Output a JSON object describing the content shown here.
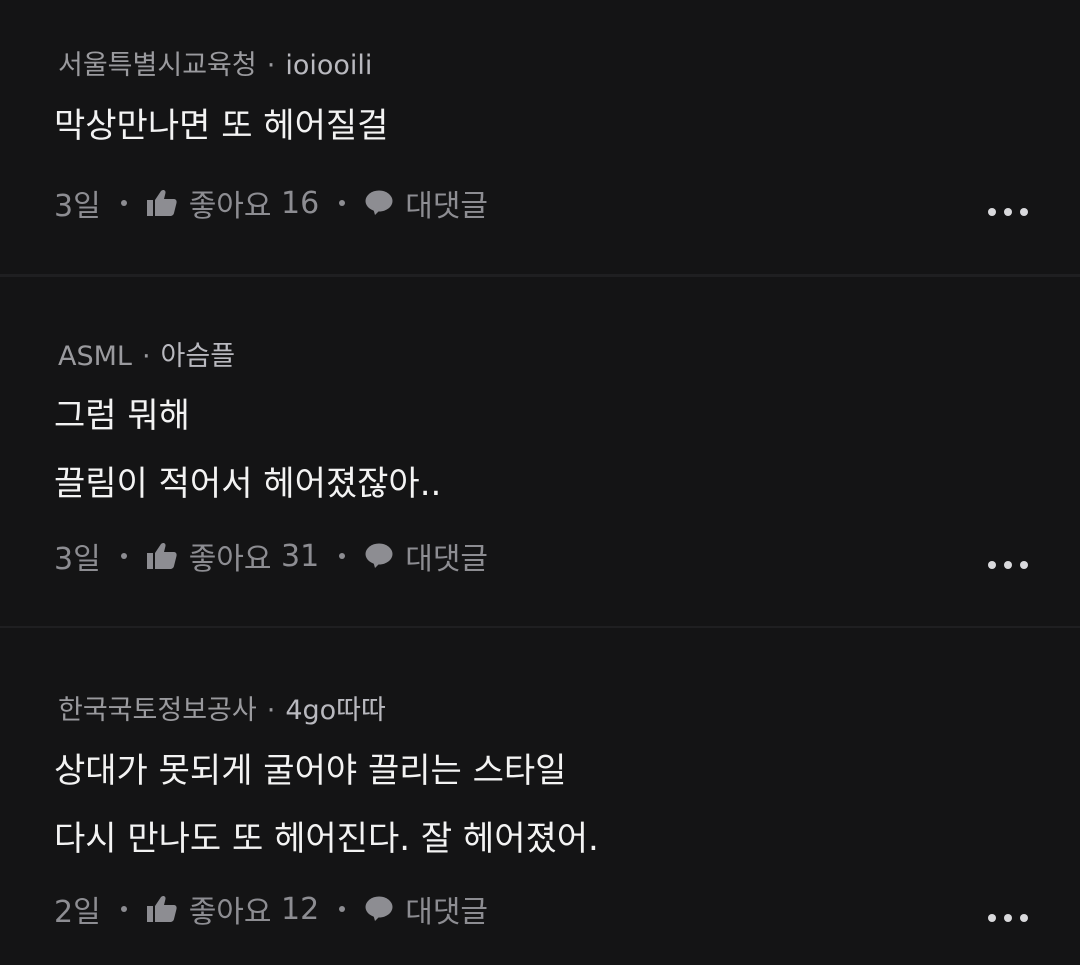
{
  "comments": [
    {
      "org": "서울특별시교육청",
      "nick": "ioiooili",
      "lines": [
        "막상만나면 또 헤어질걸"
      ],
      "time": "3일",
      "like_label": "좋아요",
      "like_count": "16",
      "reply_label": "대댓글"
    },
    {
      "org": "ASML",
      "nick": "아슴플",
      "lines": [
        "그럼 뭐해",
        "끌림이 적어서 헤어졌잖아.."
      ],
      "time": "3일",
      "like_label": "좋아요",
      "like_count": "31",
      "reply_label": "대댓글"
    },
    {
      "org": "한국국토정보공사",
      "nick": "4go따따",
      "lines": [
        "상대가 못되게 굴어야 끌리는 스타일",
        "다시 만나도 또 헤어진다. 잘 헤어졌어."
      ],
      "time": "2일",
      "like_label": "좋아요",
      "like_count": "12",
      "reply_label": "대댓글"
    }
  ],
  "separator": "·",
  "icons": {
    "like": "thumbs-up-icon",
    "reply": "speech-bubble-icon",
    "more": "more-horizontal-icon"
  },
  "colors": {
    "background": "#141415",
    "divider": "#1f1f21",
    "text_primary": "#f3f3f3",
    "text_secondary": "#9a9a9e"
  }
}
